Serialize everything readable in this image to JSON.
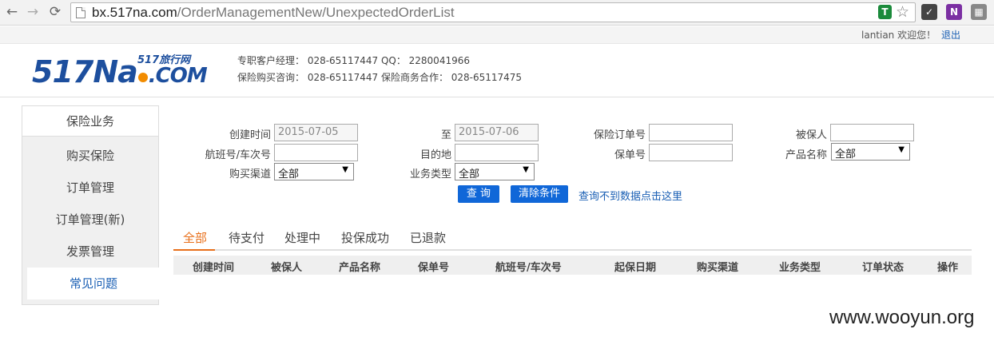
{
  "browser": {
    "url_host": "bx.517na.com",
    "url_path": "/OrderManagementNew/UnexpectedOrderList",
    "back_icon": "arrow-left",
    "forward_icon": "arrow-right",
    "reload_icon": "reload",
    "star_icon": "star"
  },
  "topbar": {
    "user": "lantian  欢迎您！",
    "logout": "退出"
  },
  "header": {
    "logo_main_a": "517N",
    "logo_main_b": "a",
    "logo_main_c": ".COM",
    "logo_sub": "517旅行网",
    "contact_line1": "专职客户经理：  028-65117447  QQ：  2280041966",
    "contact_line2": "保险购买咨询：  028-65117447   保险商务合作：  028-65117475"
  },
  "sidebar": {
    "title": "保险业务",
    "items": [
      {
        "label": "购买保险"
      },
      {
        "label": "订单管理"
      },
      {
        "label": "订单管理(新)"
      },
      {
        "label": "发票管理"
      },
      {
        "label": "常见问题"
      }
    ]
  },
  "form": {
    "create_time_label": "创建时间",
    "create_time_from": "2015-07-05",
    "to_label": "至",
    "create_time_to": "2015-07-06",
    "order_no_label": "保险订单号",
    "order_no_value": "",
    "insured_label": "被保人",
    "insured_value": "",
    "flight_label": "航班号/车次号",
    "flight_value": "",
    "destination_label": "目的地",
    "destination_value": "",
    "policy_label": "保单号",
    "policy_value": "",
    "product_label": "产品名称",
    "product_value": "全部",
    "channel_label": "购买渠道",
    "channel_value": "全部",
    "biz_type_label": "业务类型",
    "biz_type_value": "全部",
    "search_button": "查 询",
    "clear_button": "清除条件",
    "no_data_link": "查询不到数据点击这里"
  },
  "tabs": [
    {
      "label": "全部",
      "active": true
    },
    {
      "label": "待支付"
    },
    {
      "label": "处理中"
    },
    {
      "label": "投保成功"
    },
    {
      "label": "已退款"
    }
  ],
  "table": {
    "columns": [
      "创建时间",
      "被保人",
      "产品名称",
      "保单号",
      "航班号/车次号",
      "起保日期",
      "购买渠道",
      "业务类型",
      "订单状态",
      "操作"
    ]
  },
  "watermark": "www.wooyun.org",
  "colors": {
    "accent": "#1067d8",
    "tab_active": "#e86f1a",
    "logo_blue": "#1d4f9e",
    "logo_orange": "#f28c00"
  }
}
